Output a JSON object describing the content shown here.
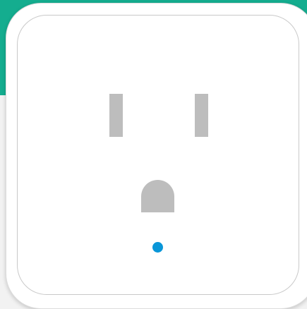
{
  "colors": {
    "accent": "#14ad8f",
    "slot": "#bdbdbd",
    "led": "#0996d8"
  },
  "device": {
    "indicator_icon": "status-led-icon"
  }
}
